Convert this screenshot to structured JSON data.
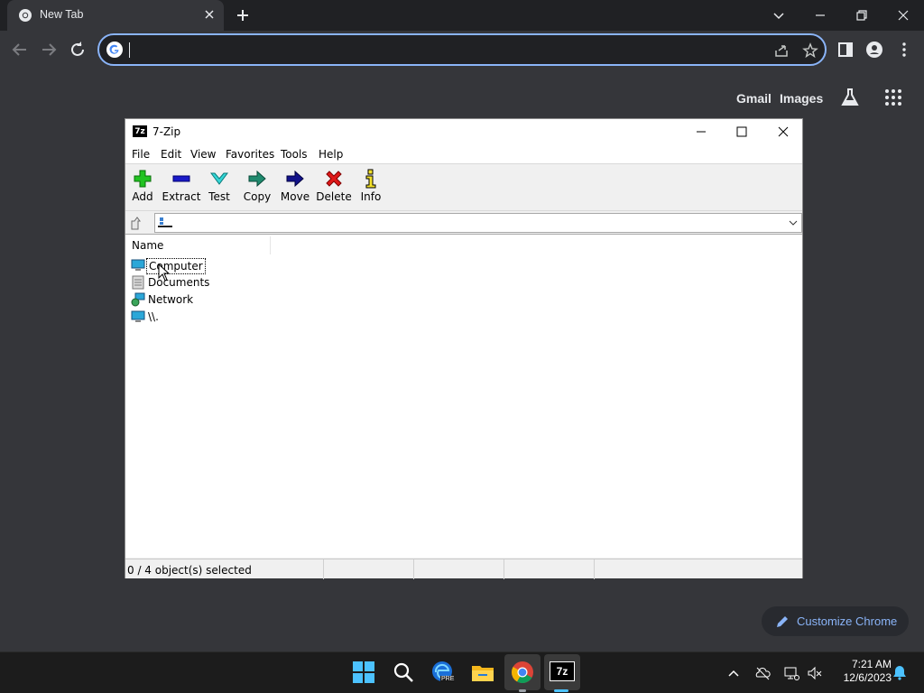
{
  "browser": {
    "tab_title": "New Tab",
    "omnibox_value": "",
    "ntp_links": {
      "gmail": "Gmail",
      "images": "Images"
    },
    "customize_label": "Customize Chrome"
  },
  "sevenzip": {
    "window_title": "7-Zip",
    "app_icon_text": "7z",
    "menu": [
      "File",
      "Edit",
      "View",
      "Favorites",
      "Tools",
      "Help"
    ],
    "tools": [
      "Add",
      "Extract",
      "Test",
      "Copy",
      "Move",
      "Delete",
      "Info"
    ],
    "path_value": "",
    "column_name": "Name",
    "items": [
      "Computer",
      "Documents",
      "Network",
      "\\\\."
    ],
    "status": "0 / 4 object(s) selected"
  },
  "taskbar": {
    "time": "7:21 AM",
    "date": "12/6/2023",
    "pinned": [
      "windows-start-icon",
      "search-icon",
      "edge-beta-icon",
      "file-explorer-icon",
      "chrome-icon",
      "7zip-icon"
    ],
    "edge_badge": "PRE",
    "sevenzip_badge": "7z"
  },
  "colors": {
    "accent": "#8ab4f8",
    "tab_bg": "#35363a",
    "frame": "#202124",
    "taskbar": "#1c1c1c"
  }
}
